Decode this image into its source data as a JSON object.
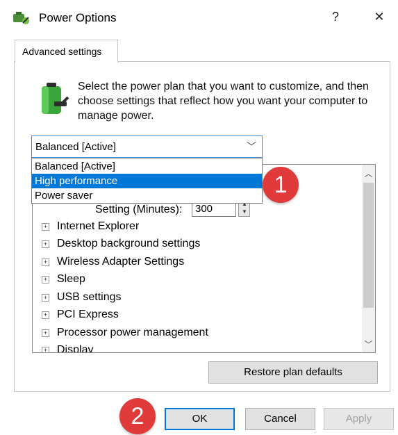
{
  "window": {
    "title": "Power Options",
    "help_label": "?",
    "close_label": "✕"
  },
  "tab": {
    "label": "Advanced settings"
  },
  "description": "Select the power plan that you want to customize, and then choose settings that reflect how you want your computer to manage power.",
  "plan_select": {
    "value": "Balanced [Active]",
    "options": [
      "Balanced [Active]",
      "High performance",
      "Power saver"
    ],
    "highlighted": "High performance"
  },
  "settings_tree": {
    "setting_label": "Setting (Minutes):",
    "setting_value": "300",
    "items": [
      "Internet Explorer",
      "Desktop background settings",
      "Wireless Adapter Settings",
      "Sleep",
      "USB settings",
      "PCI Express",
      "Processor power management",
      "Display"
    ]
  },
  "buttons": {
    "restore": "Restore plan defaults",
    "ok": "OK",
    "cancel": "Cancel",
    "apply": "Apply"
  },
  "markers": {
    "one": "1",
    "two": "2"
  },
  "colors": {
    "accent": "#0078d7",
    "marker": "#e03a3a"
  }
}
